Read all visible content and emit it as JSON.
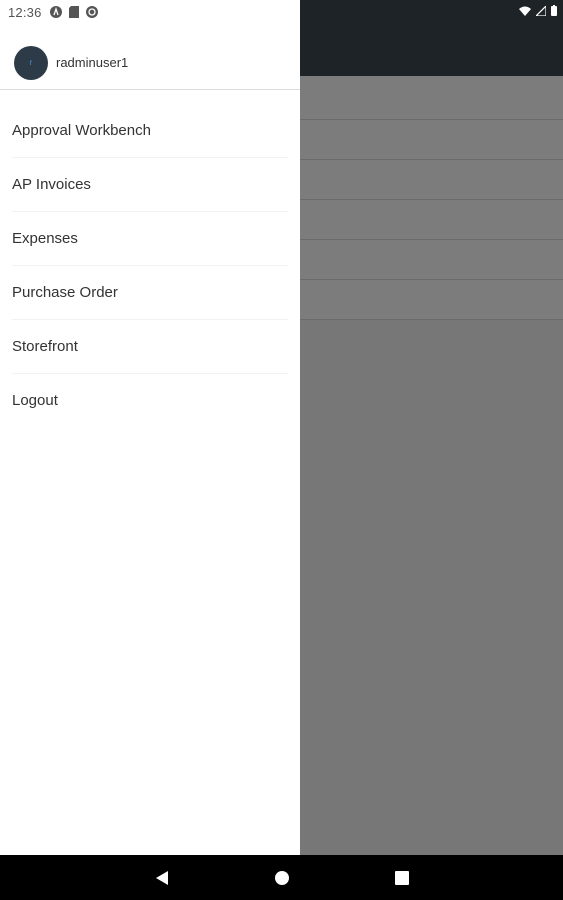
{
  "status_bar": {
    "time": "12:36",
    "left_icons": [
      "notification-a-icon",
      "sd-card-icon",
      "sync-icon"
    ],
    "right_icons": [
      "wifi-icon",
      "signal-icon",
      "battery-icon"
    ]
  },
  "drawer": {
    "avatar_letter": "r",
    "username": "radminuser1",
    "items": [
      {
        "label": "Approval Workbench"
      },
      {
        "label": "AP Invoices"
      },
      {
        "label": "Expenses"
      },
      {
        "label": "Purchase Order"
      },
      {
        "label": "Storefront"
      },
      {
        "label": "Logout"
      }
    ]
  },
  "nav_bar": {
    "buttons": [
      "back-icon",
      "home-icon",
      "recents-icon"
    ]
  },
  "colors": {
    "app_header": "#1e2328",
    "scrim": "#7a7a7a",
    "drawer_bg": "#ffffff",
    "avatar_bg": "#2d3b48",
    "nav_bar": "#000000"
  }
}
